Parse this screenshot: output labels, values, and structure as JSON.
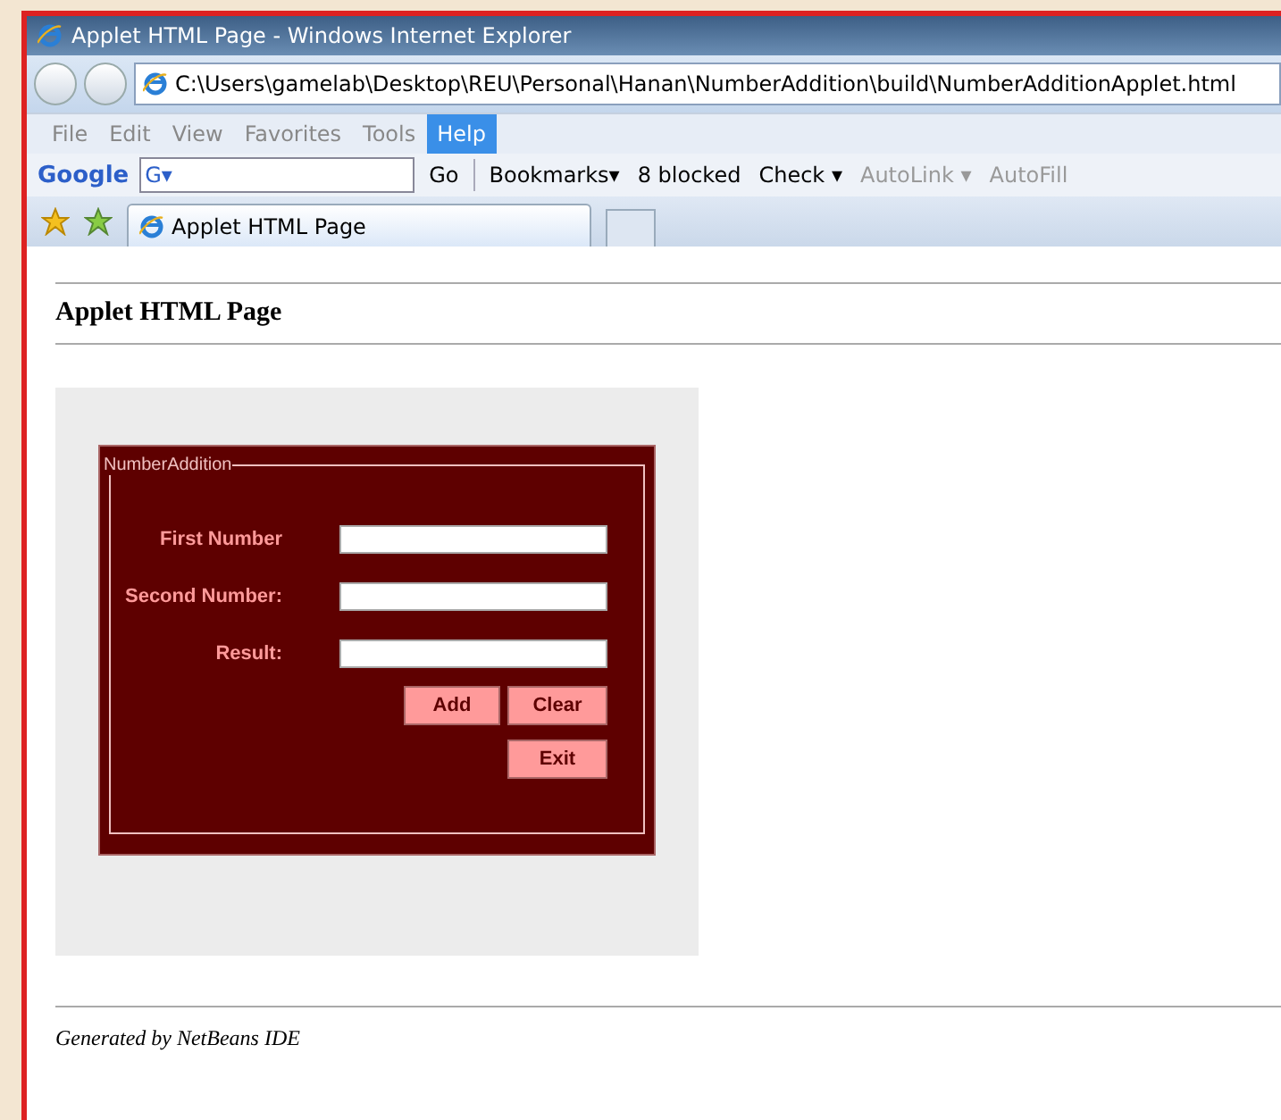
{
  "window": {
    "title": "Applet HTML Page - Windows Internet Explorer"
  },
  "address": {
    "value": "C:\\Users\\gamelab\\Desktop\\REU\\Personal\\Hanan\\NumberAddition\\build\\NumberAdditionApplet.html"
  },
  "menu": [
    {
      "label": "File",
      "selected": false
    },
    {
      "label": "Edit",
      "selected": false
    },
    {
      "label": "View",
      "selected": false
    },
    {
      "label": "Favorites",
      "selected": false
    },
    {
      "label": "Tools",
      "selected": false
    },
    {
      "label": "Help",
      "selected": true
    }
  ],
  "toolbar": {
    "logo": "Google",
    "search_prefix": "G▾",
    "go": "Go",
    "items": [
      {
        "label": "Bookmarks▾",
        "disabled": false
      },
      {
        "label": "8 blocked",
        "disabled": false
      },
      {
        "label": "Check ▾",
        "disabled": false
      },
      {
        "label": "AutoLink ▾",
        "disabled": true
      },
      {
        "label": "AutoFill",
        "disabled": true
      }
    ]
  },
  "tabs": [
    {
      "label": "Applet HTML Page",
      "selected": true
    }
  ],
  "page": {
    "heading": "Applet HTML Page",
    "applet": {
      "group_title": "NumberAddition",
      "fields": [
        {
          "label": "First Number"
        },
        {
          "label": "Second Number:"
        },
        {
          "label": "Result:"
        }
      ],
      "buttons": [
        "Add",
        "Clear",
        "Exit"
      ]
    },
    "footer": "Generated by NetBeans IDE"
  }
}
